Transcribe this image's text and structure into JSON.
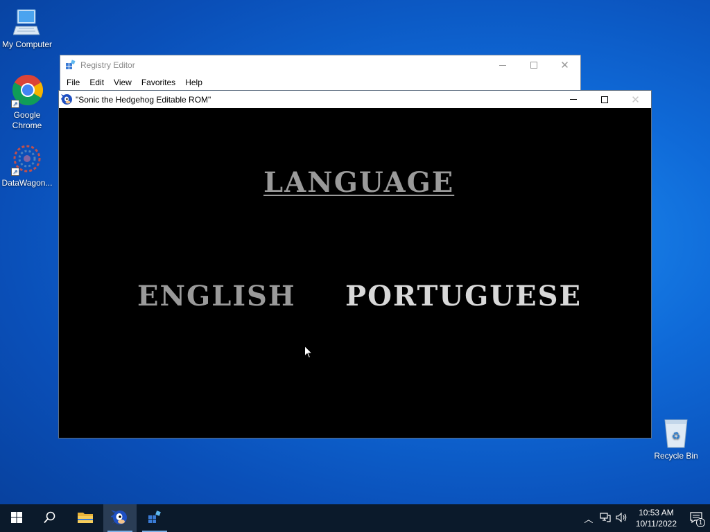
{
  "desktop": {
    "icons": [
      {
        "label": "My Computer"
      },
      {
        "label": "Google Chrome"
      },
      {
        "label": "DataWagon..."
      },
      {
        "label": "Recycle Bin"
      }
    ]
  },
  "registry_window": {
    "title": "Registry Editor",
    "menu": [
      "File",
      "Edit",
      "View",
      "Favorites",
      "Help"
    ]
  },
  "game_window": {
    "title": "\"Sonic the Hedgehog Editable ROM\"",
    "heading": "LANGUAGE",
    "options": [
      "ENGLISH",
      "PORTUGUESE"
    ]
  },
  "taskbar": {
    "time": "10:53 AM",
    "date": "10/11/2022",
    "notification_count": "1"
  },
  "colors": {
    "game_bg": "#000000",
    "game_text_dim": "#9a9a9a",
    "game_text_bright": "#d8d8d8",
    "taskbar_bg": "#0b1a2b"
  }
}
